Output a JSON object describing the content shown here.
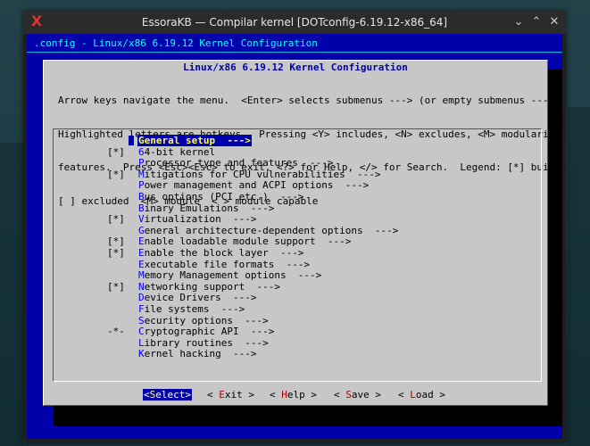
{
  "window": {
    "title": "EssoraKB — Compilar kernel [DOTconfig-6.19.12-x86_64]",
    "app_icon": "X",
    "minimize_glyph": "⌄",
    "maximize_glyph": "⌃",
    "close_glyph": "✕"
  },
  "terminal": {
    "header": ".config - Linux/x86 6.19.12 Kernel Configuration",
    "dialog_title": " Linux/x86 6.19.12 Kernel Configuration ",
    "help_lines": [
      "Arrow keys navigate the menu.  <Enter> selects submenus ---> (or empty submenus ----).",
      "Highlighted letters are hotkeys.  Pressing <Y> includes, <N> excludes, <M> modularizes",
      "features.  Press <Esc><Esc> to exit, <?> for Help, </> for Search.  Legend: [*] built-in",
      "[ ] excluded  <M> module  < > module capable"
    ],
    "menu": [
      {
        "prefix": "",
        "hot": "G",
        "rest": "eneral setup  --->",
        "selected": true
      },
      {
        "prefix": "[*]",
        "hot": "6",
        "rest": "4-bit kernel",
        "selected": false
      },
      {
        "prefix": "",
        "hot": "P",
        "rest": "rocessor type and features  --->",
        "selected": false
      },
      {
        "prefix": "[*]",
        "hot": "M",
        "rest": "itigations for CPU vulnerabilities  --->",
        "selected": false
      },
      {
        "prefix": "",
        "hot": "P",
        "rest": "ower management and ACPI options  --->",
        "selected": false
      },
      {
        "prefix": "",
        "hot": "B",
        "rest": "us options (PCI etc.)  --->",
        "selected": false
      },
      {
        "prefix": "",
        "hot": "B",
        "rest": "inary Emulations  --->",
        "selected": false
      },
      {
        "prefix": "[*]",
        "hot": "V",
        "rest": "irtualization  --->",
        "selected": false
      },
      {
        "prefix": "",
        "hot": "G",
        "rest": "eneral architecture-dependent options  --->",
        "selected": false
      },
      {
        "prefix": "[*]",
        "hot": "E",
        "rest": "nable loadable module support  --->",
        "selected": false
      },
      {
        "prefix": "[*]",
        "hot": "E",
        "rest": "nable the block layer  --->",
        "selected": false
      },
      {
        "prefix": "",
        "hot": "E",
        "rest": "xecutable file formats  --->",
        "selected": false
      },
      {
        "prefix": "",
        "hot": "M",
        "rest": "emory Management options  --->",
        "selected": false
      },
      {
        "prefix": "[*]",
        "hot": "N",
        "rest": "etworking support  --->",
        "selected": false
      },
      {
        "prefix": "",
        "hot": "D",
        "rest": "evice Drivers  --->",
        "selected": false
      },
      {
        "prefix": "",
        "hot": "F",
        "rest": "ile systems  --->",
        "selected": false
      },
      {
        "prefix": "",
        "hot": "S",
        "rest": "ecurity options  --->",
        "selected": false
      },
      {
        "prefix": "-*-",
        "hot": "C",
        "rest": "ryptographic API  --->",
        "selected": false
      },
      {
        "prefix": "",
        "hot": "L",
        "rest": "ibrary routines  --->",
        "selected": false
      },
      {
        "prefix": "",
        "hot": "K",
        "rest": "ernel hacking  --->",
        "selected": false
      }
    ],
    "buttons": [
      {
        "open": "<",
        "hot": "S",
        "rest": "elect",
        "close": ">",
        "selected": true
      },
      {
        "open": "< ",
        "hot": "E",
        "rest": "xit",
        "close": " >",
        "selected": false
      },
      {
        "open": "< ",
        "hot": "H",
        "rest": "elp",
        "close": " >",
        "selected": false
      },
      {
        "open": "< ",
        "hot": "S",
        "rest": "ave",
        "close": " >",
        "selected": false
      },
      {
        "open": "< ",
        "hot": "L",
        "rest": "oad",
        "close": " >",
        "selected": false
      }
    ]
  },
  "colors": {
    "terminal_bg": "#0000aa",
    "dialog_bg": "#c7c7c7",
    "hotkey": "#0000ff",
    "selection_fg": "#ffff55"
  }
}
